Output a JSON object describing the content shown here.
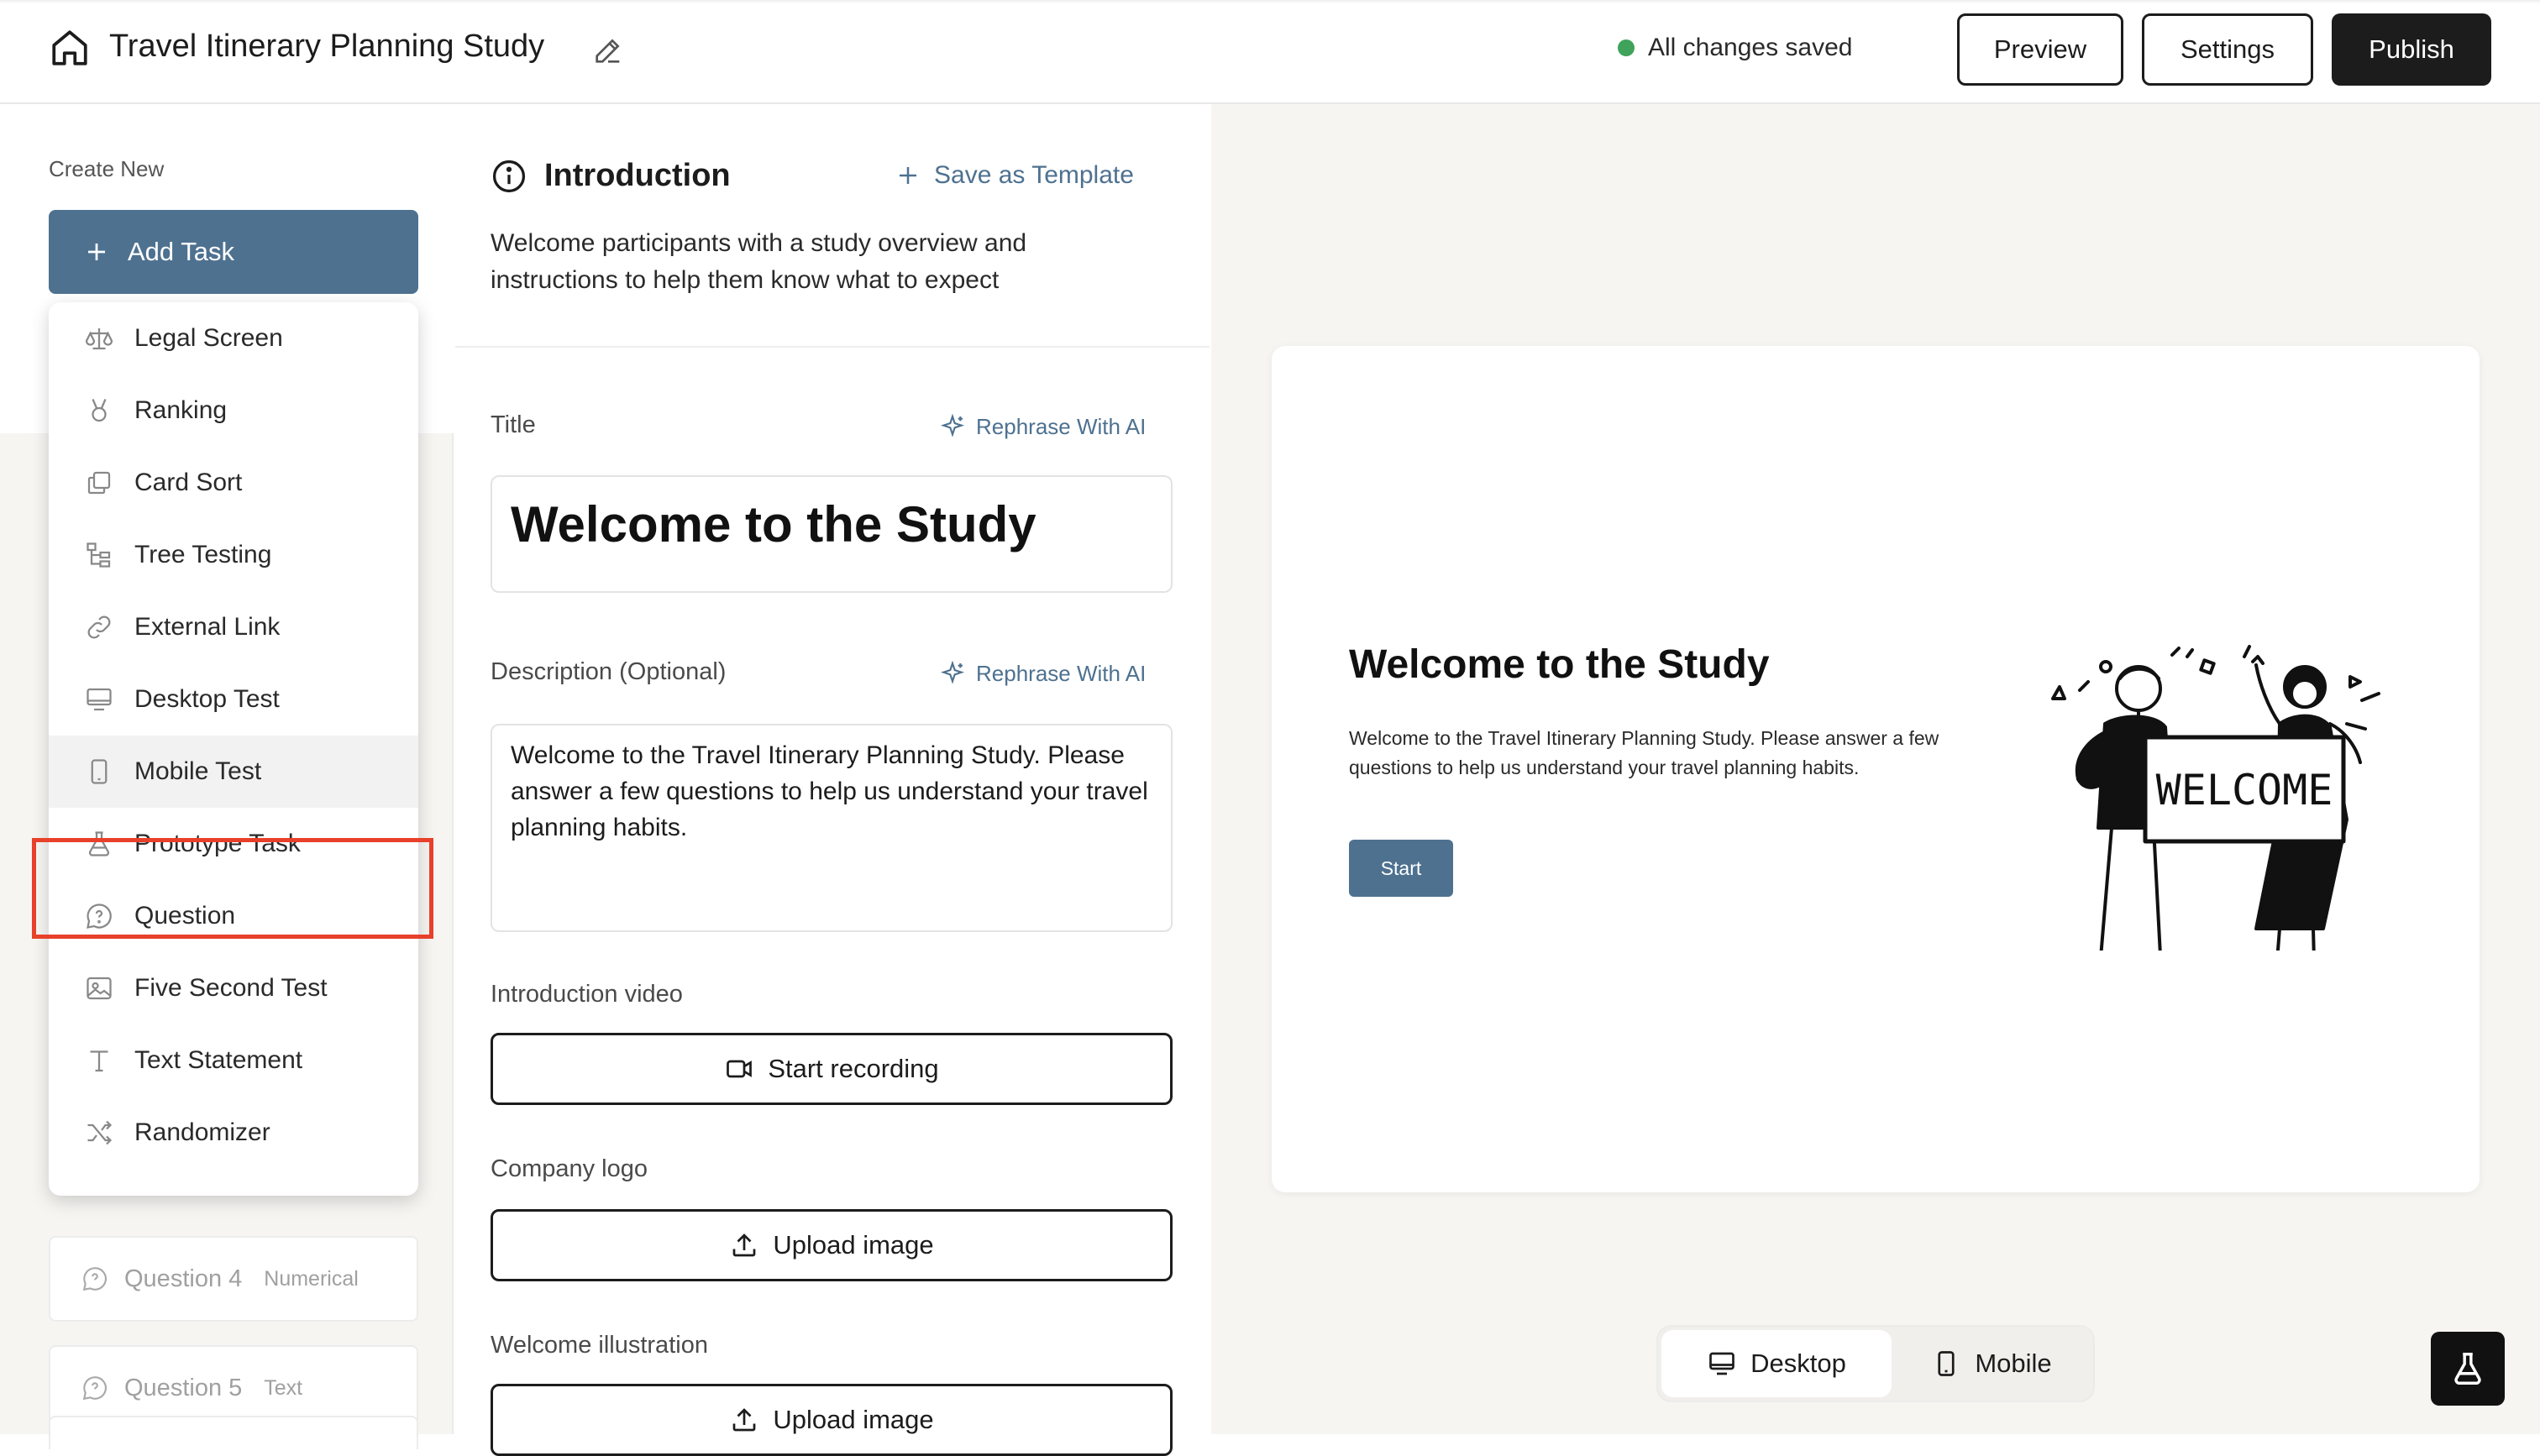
{
  "header": {
    "title": "Travel Itinerary Planning Study",
    "save_status": "All changes saved",
    "status_color": "#3fa35b",
    "preview_label": "Preview",
    "settings_label": "Settings",
    "publish_label": "Publish"
  },
  "sidebar": {
    "create_new_label": "Create New",
    "add_task_label": "Add Task",
    "menu": [
      {
        "label": "Legal Screen",
        "icon": "scale-icon"
      },
      {
        "label": "Ranking",
        "icon": "medal-icon"
      },
      {
        "label": "Card Sort",
        "icon": "cards-icon"
      },
      {
        "label": "Tree Testing",
        "icon": "tree-icon"
      },
      {
        "label": "External Link",
        "icon": "link-icon"
      },
      {
        "label": "Desktop Test",
        "icon": "monitor-icon"
      },
      {
        "label": "Mobile Test",
        "icon": "phone-icon"
      },
      {
        "label": "Prototype Task",
        "icon": "flask-icon"
      },
      {
        "label": "Question",
        "icon": "question-bubble-icon"
      },
      {
        "label": "Five Second Test",
        "icon": "image-icon"
      },
      {
        "label": "Text Statement",
        "icon": "text-icon"
      },
      {
        "label": "Randomizer",
        "icon": "shuffle-icon"
      }
    ],
    "tasks_below": [
      {
        "label": "Question 4",
        "type": "Numerical"
      },
      {
        "label": "Question 5",
        "type": "Text"
      }
    ]
  },
  "editor": {
    "section_title": "Introduction",
    "save_template_label": "Save as Template",
    "section_description": "Welcome participants with a study overview and instructions to help them know what to expect",
    "title_label": "Title",
    "rephrase_label": "Rephrase With AI",
    "title_value": "Welcome to the Study",
    "description_label": "Description (Optional)",
    "description_value": "Welcome to the Travel Itinerary Planning Study. Please answer a few questions to help us understand your travel planning habits.",
    "video_label": "Introduction video",
    "start_recording_label": "Start recording",
    "logo_label": "Company logo",
    "upload_image_label": "Upload image",
    "illustration_label": "Welcome illustration"
  },
  "preview": {
    "heading": "Welcome to the Study",
    "body": "Welcome to the Travel Itinerary Planning Study. Please answer a few questions to help us understand your travel planning habits.",
    "start_label": "Start",
    "sign_text": "WELCOME",
    "toggle": {
      "desktop_label": "Desktop",
      "mobile_label": "Mobile",
      "selected": "Desktop"
    }
  },
  "colors": {
    "accent": "#4e7190",
    "dark": "#1c1c1c",
    "highlight": "#e8402a"
  }
}
